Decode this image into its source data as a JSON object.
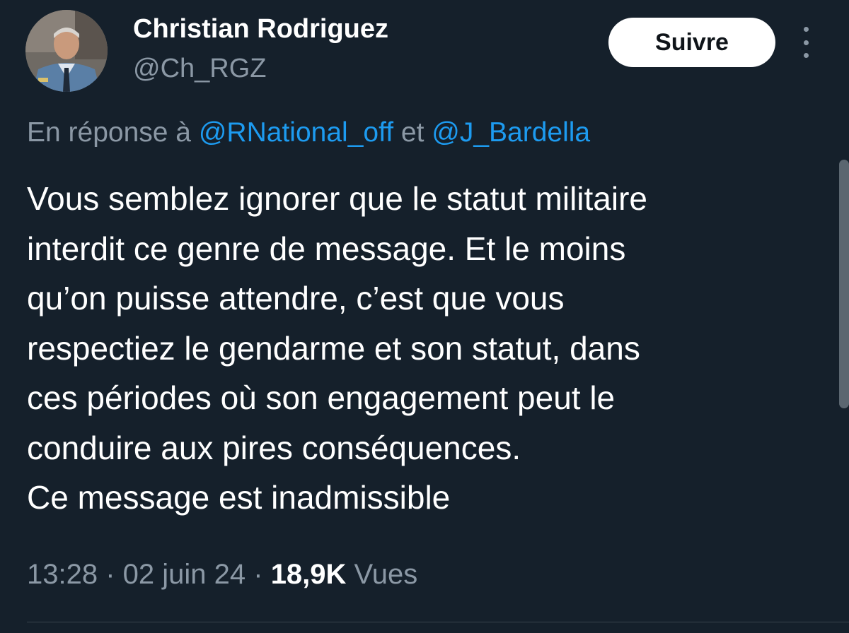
{
  "user": {
    "display_name": "Christian Rodriguez",
    "handle": "@Ch_RGZ"
  },
  "actions": {
    "follow_label": "Suivre",
    "more_icon": "more-vertical-icon"
  },
  "reply": {
    "prefix": "En réponse à ",
    "mention_1": "@RNational_off",
    "connector": " et ",
    "mention_2": "@J_Bardella"
  },
  "tweet": {
    "lines": [
      "Vous semblez ignorer que le statut militaire",
      "interdit ce genre de message. Et le moins",
      "qu’on puisse attendre, c’est que vous",
      "respectiez le gendarme et son statut, dans",
      "ces périodes où son engagement peut le",
      "conduire aux pires conséquences.",
      "Ce message est inadmissible"
    ]
  },
  "meta": {
    "time": "13:28",
    "separator": " · ",
    "date": "02 juin 24",
    "views_count": "18,9K",
    "views_label": " Vues"
  },
  "colors": {
    "background": "#15202b",
    "secondary_text": "#8b98a5",
    "link": "#1d9bf0"
  }
}
